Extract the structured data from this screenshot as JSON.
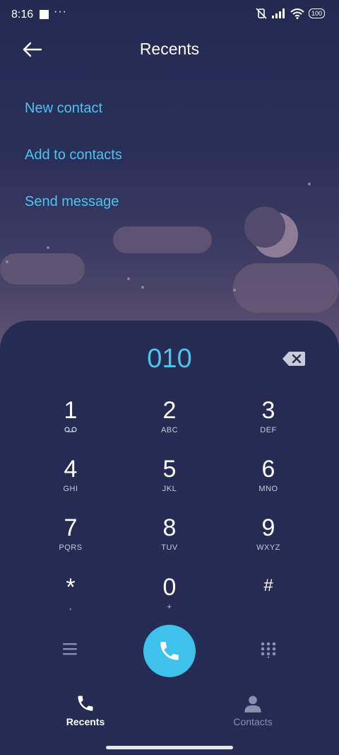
{
  "status_bar": {
    "time": "8:16",
    "more": "···",
    "battery": "100"
  },
  "header": {
    "title": "Recents"
  },
  "actions": [
    {
      "label": "New contact"
    },
    {
      "label": "Add to contacts"
    },
    {
      "label": "Send message"
    }
  ],
  "dialer": {
    "number": "010",
    "keys": [
      {
        "digit": "1",
        "letters": ""
      },
      {
        "digit": "2",
        "letters": "ABC"
      },
      {
        "digit": "3",
        "letters": "DEF"
      },
      {
        "digit": "4",
        "letters": "GHI"
      },
      {
        "digit": "5",
        "letters": "JKL"
      },
      {
        "digit": "6",
        "letters": "MNO"
      },
      {
        "digit": "7",
        "letters": "PQRS"
      },
      {
        "digit": "8",
        "letters": "TUV"
      },
      {
        "digit": "9",
        "letters": "WXYZ"
      },
      {
        "digit": "*",
        "letters": ","
      },
      {
        "digit": "0",
        "letters": "+"
      },
      {
        "digit": "#",
        "letters": ""
      }
    ]
  },
  "tabs": [
    {
      "label": "Recents",
      "active": true
    },
    {
      "label": "Contacts",
      "active": false
    }
  ],
  "colors": {
    "accent": "#4cc4ee",
    "panel": "#252b52",
    "call_button": "#3ec1ea"
  }
}
